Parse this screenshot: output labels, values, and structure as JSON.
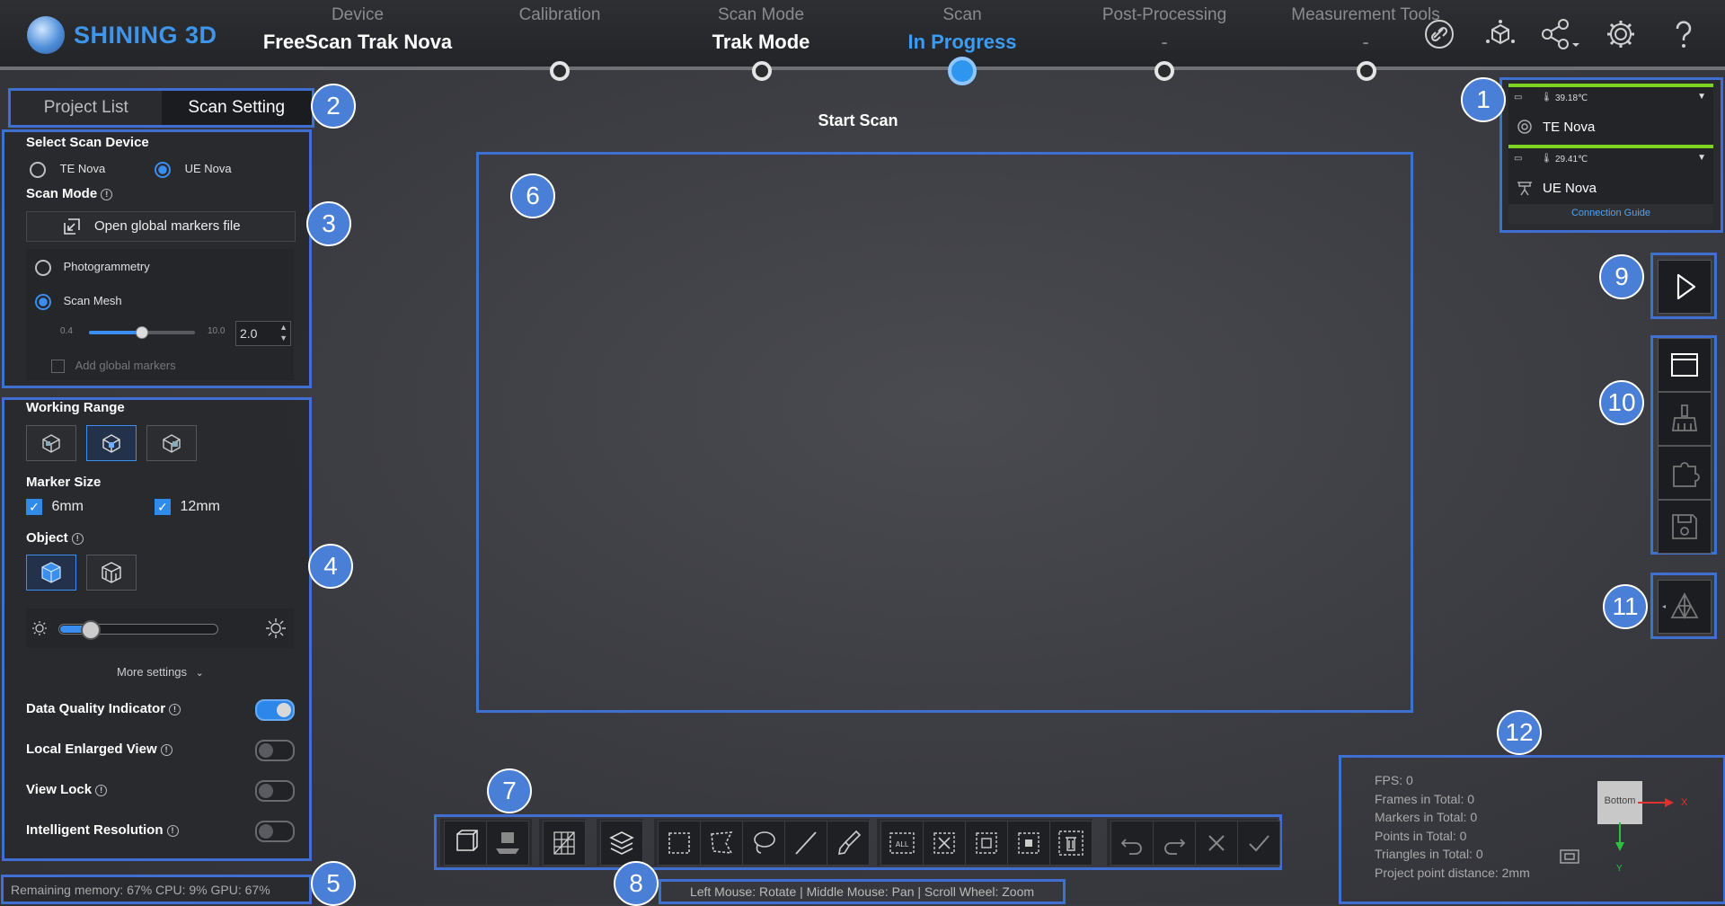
{
  "app": {
    "brand": "SHINING 3D"
  },
  "steps": [
    {
      "label": "Device",
      "value": "FreeScan Trak Nova",
      "state": "done"
    },
    {
      "label": "Calibration",
      "value": "",
      "state": "pending"
    },
    {
      "label": "Scan Mode",
      "value": "Trak Mode",
      "state": "done"
    },
    {
      "label": "Scan",
      "value": "In Progress",
      "state": "active"
    },
    {
      "label": "Post-Processing",
      "value": "-",
      "state": "pending"
    },
    {
      "label": "Measurement Tools",
      "value": "-",
      "state": "pending"
    }
  ],
  "top_icons": [
    "link-icon",
    "cube-network-icon",
    "share-icon",
    "gear-icon",
    "help-icon"
  ],
  "tabs": {
    "project_list": "Project List",
    "scan_setting": "Scan Setting"
  },
  "scan_device": {
    "title": "Select Scan Device",
    "options": [
      "TE Nova",
      "UE Nova"
    ],
    "selected": "UE Nova"
  },
  "scan_mode": {
    "title": "Scan Mode",
    "open_markers": "Open global markers file",
    "photogrammetry": "Photogrammetry",
    "scan_mesh": "Scan Mesh",
    "slider_min": "0.4",
    "slider_max": "10.0",
    "value": "2.0",
    "add_markers": "Add global markers"
  },
  "working_range": {
    "title": "Working Range"
  },
  "marker_size": {
    "title": "Marker Size",
    "options": [
      "6mm",
      "12mm"
    ]
  },
  "object": {
    "title": "Object"
  },
  "more_settings": "More settings",
  "toggles": [
    {
      "label": "Data Quality Indicator",
      "on": true
    },
    {
      "label": "Local Enlarged View",
      "on": false
    },
    {
      "label": "View Lock",
      "on": false
    },
    {
      "label": "Intelligent Resolution",
      "on": false
    }
  ],
  "status": "Remaining memory: 67% CPU: 9% GPU: 67%",
  "viewport": {
    "title": "Start Scan"
  },
  "hint": "Left Mouse: Rotate | Middle Mouse: Pan | Scroll Wheel: Zoom",
  "devices": [
    {
      "temp": "39.18℃",
      "name": "TE Nova"
    },
    {
      "temp": "29.41℃",
      "name": "UE Nova"
    }
  ],
  "connection_guide": "Connection Guide",
  "stats": [
    "FPS: 0",
    "Frames in Total: 0",
    "Markers in Total: 0",
    "Points in Total: 0",
    "Triangles in Total: 0",
    "Project point distance: 2mm"
  ],
  "axis": {
    "face": "Bottom",
    "x": "X",
    "y": "Y"
  },
  "callouts": [
    "1",
    "2",
    "3",
    "4",
    "5",
    "6",
    "7",
    "8",
    "9",
    "10",
    "11",
    "12"
  ],
  "colors": {
    "accent": "#3a9cf2",
    "outline": "#3f6fd0",
    "callout": "#4a7fd8"
  }
}
